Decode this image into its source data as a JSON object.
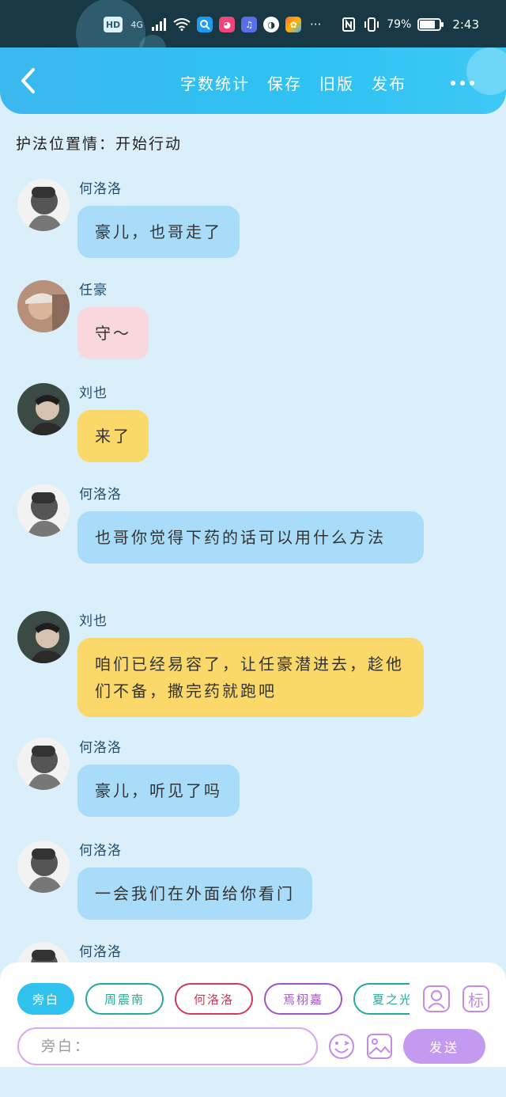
{
  "status_bar": {
    "hd": "HD",
    "network": "4G",
    "battery_text": "79%",
    "battery_level": 0.79,
    "time": "2:43",
    "more": "···"
  },
  "header": {
    "actions": [
      "字数统计",
      "保存",
      "旧版",
      "发布"
    ]
  },
  "chapter": {
    "title": "护法位置情：开始行动"
  },
  "messages": [
    {
      "speaker": "何洛洛",
      "text": "豪儿，也哥走了",
      "color": "blue",
      "avatar": "boy-gray"
    },
    {
      "speaker": "任豪",
      "text": "守～",
      "color": "pink",
      "avatar": "boy-hat"
    },
    {
      "speaker": "刘也",
      "text": "来了",
      "color": "yellow",
      "avatar": "boy-dark"
    },
    {
      "speaker": "何洛洛",
      "text": "也哥你觉得下药的话可以用什么方法",
      "color": "blue",
      "avatar": "boy-gray"
    },
    {
      "speaker": "刘也",
      "text": "咱们已经易容了，让任豪潜进去，趁他们不备，撒完药就跑吧",
      "color": "yellow",
      "avatar": "boy-dark"
    },
    {
      "speaker": "何洛洛",
      "text": "豪儿，听见了吗",
      "color": "blue",
      "avatar": "boy-gray"
    },
    {
      "speaker": "何洛洛",
      "text": "一会我们在外面给你看门",
      "color": "blue",
      "avatar": "boy-gray"
    },
    {
      "speaker": "何洛洛",
      "text": "",
      "color": "blue",
      "avatar": "boy-gray"
    }
  ],
  "characters": [
    {
      "label": "旁白",
      "style": "active"
    },
    {
      "label": "周震南",
      "style": "teal"
    },
    {
      "label": "何洛洛",
      "style": "red"
    },
    {
      "label": "焉栩嘉",
      "style": "purple"
    },
    {
      "label": "夏之光",
      "style": "teal2"
    }
  ],
  "tools": {
    "role_icon": "person-card-icon",
    "mark_label": "标"
  },
  "composer": {
    "placeholder": "旁白：",
    "send_label": "发送"
  },
  "colors": {
    "accent": "#31c1ef",
    "blue_bubble": "#a8dcf9",
    "pink_bubble": "#f8d7dd",
    "yellow_bubble": "#fbd86a",
    "send": "#c49af0"
  }
}
